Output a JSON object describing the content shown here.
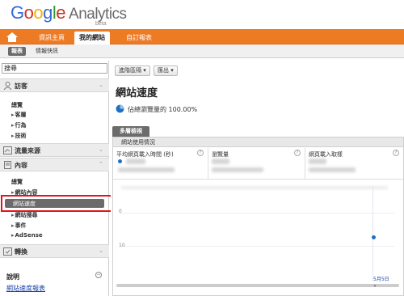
{
  "header": {
    "logo_word": "Google",
    "product": "Analytics",
    "badge": "beta"
  },
  "tabs": [
    {
      "label": "資訊主頁",
      "active": false
    },
    {
      "label": "我的網站",
      "active": true
    },
    {
      "label": "自訂報表",
      "active": false
    }
  ],
  "subnav": [
    {
      "label": "報表",
      "selected": true
    },
    {
      "label": "情報快訊",
      "selected": false
    }
  ],
  "sidebar": {
    "search_value": "搜尋",
    "sections": {
      "visitors": "訪客",
      "traffic": "流量來源",
      "content": "內容",
      "conversions": "轉換"
    },
    "visitor_items": [
      "總覽",
      "客層",
      "行為",
      "技術"
    ],
    "content_items": [
      "總覽",
      "網站內容",
      "網站速度",
      "網站搜尋",
      "事件",
      "AdSense"
    ],
    "selected_item": "網站速度",
    "help_title": "說明",
    "help_link": "網站速度報表"
  },
  "toolbar": {
    "segments_label": "進階區隔",
    "export_label": "匯出"
  },
  "main": {
    "page_title": "網站速度",
    "sample_text": "佔總瀏覽量的 100.00%",
    "tab_overview": "多層檢視",
    "panel_title": "網站使用情況",
    "metrics": [
      "平均網頁載入時間 (秒)",
      "瀏覽量",
      "網頁載入取樣"
    ],
    "y_ticks": [
      "0",
      "10"
    ],
    "date_label": "5月5日"
  },
  "colors": {
    "brand_orange": "#ed7b24",
    "selected_gray": "#6b6b6b",
    "highlight_red": "#e2131c",
    "dot_blue": "#1f6fc4"
  }
}
